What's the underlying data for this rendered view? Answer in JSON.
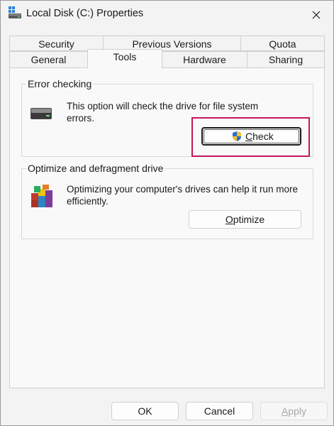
{
  "window": {
    "title": "Local Disk (C:) Properties",
    "title_icon": "drive-icon",
    "close_icon": "close-icon"
  },
  "tabs": {
    "row1": [
      "Security",
      "Previous Versions",
      "Quota"
    ],
    "row2": [
      "General",
      "Tools",
      "Hardware",
      "Sharing"
    ],
    "active": "Tools"
  },
  "error_checking": {
    "legend": "Error checking",
    "description": "This option will check the drive for file system errors.",
    "button_label_prefix": "",
    "button_mnemonic": "C",
    "button_label_rest": "heck",
    "icon": "hard-drive-icon",
    "button_icon": "uac-shield-icon"
  },
  "optimize": {
    "legend": "Optimize and defragment drive",
    "description": "Optimizing your computer's drives can help it run more efficiently.",
    "button_mnemonic": "O",
    "button_label_rest": "ptimize",
    "icon": "defrag-icon"
  },
  "footer": {
    "ok_label": "OK",
    "cancel_label": "Cancel",
    "apply_mnemonic": "A",
    "apply_rest": "pply"
  },
  "colors": {
    "highlight": "#c2185b",
    "window_bg": "#f3f3f3",
    "panel_bg": "#f9f9f9"
  }
}
